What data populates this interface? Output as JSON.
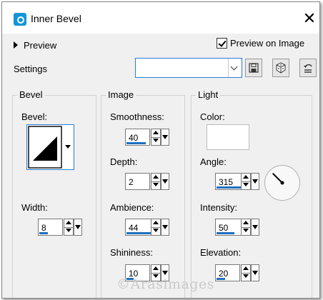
{
  "window": {
    "title": "Inner Bevel",
    "close_glyph": "✕"
  },
  "preview": {
    "label": "Preview",
    "on_image_label": "Preview on Image",
    "on_image_checked": true
  },
  "settings": {
    "label": "Settings",
    "value": "",
    "buttons": [
      "save-icon",
      "random-dice-icon",
      "reset-icon"
    ]
  },
  "bevel_group": {
    "title": "Bevel",
    "bevel_label": "Bevel:",
    "width_label": "Width:",
    "width_value": "8"
  },
  "image_group": {
    "title": "Image",
    "smoothness": {
      "label": "Smoothness:",
      "value": "40"
    },
    "depth": {
      "label": "Depth:",
      "value": "2"
    },
    "ambience": {
      "label": "Ambience:",
      "value": "44"
    },
    "shininess": {
      "label": "Shininess:",
      "value": "10"
    }
  },
  "light_group": {
    "title": "Light",
    "color_label": "Color:",
    "color_value": "#ffffff",
    "angle": {
      "label": "Angle:",
      "value": "315",
      "degrees": 315
    },
    "intensity": {
      "label": "Intensity:",
      "value": "50"
    },
    "elevation": {
      "label": "Elevation:",
      "value": "20"
    }
  },
  "watermark": "©Arasimages",
  "colors": {
    "accent": "#1f6fbf",
    "focus_border": "#2a7fd4",
    "dialog_bg": "#f0f0f0"
  }
}
